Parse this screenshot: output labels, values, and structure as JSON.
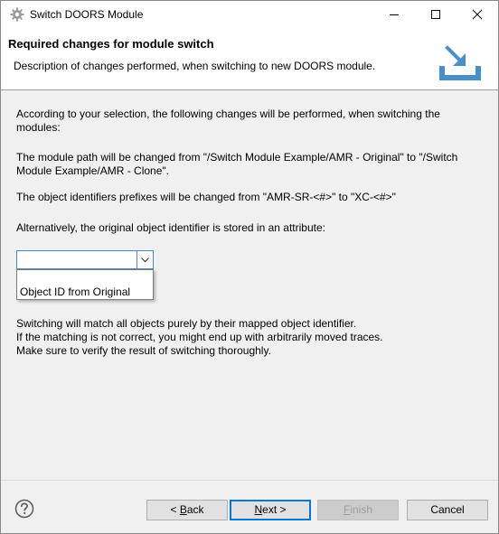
{
  "window": {
    "title": "Switch DOORS Module"
  },
  "banner": {
    "title": "Required changes for module switch",
    "description": "Description of changes performed, when switching to new DOORS module."
  },
  "content": {
    "intro_line1": "According to your selection, the following changes will be performed, when switching the",
    "intro_line2": "modules:",
    "path_line1": "The module path will be changed from \"/Switch Module Example/AMR - Original\" to \"/Switch",
    "path_line2": "Module Example/AMR - Clone\".",
    "prefix_line": "The object identifiers prefixes will be changed from \"AMR-SR-<#>\" to \"XC-<#>\"",
    "alt_line": "Alternatively, the original object identifier is stored in an attribute:",
    "attribute_combo": {
      "value": "",
      "options": [
        "",
        "Object ID from Original"
      ]
    },
    "warning_line1": "Switching will match all objects purely by their mapped object identifier.",
    "warning_line2": "If the matching is not correct, you might end up with arbitrarily moved traces.",
    "warning_line3": "Make sure to verify the result of switching thoroughly."
  },
  "buttons": {
    "back_prefix": "< ",
    "back_mnemonic": "B",
    "back_rest": "ack",
    "next_mnemonic": "N",
    "next_rest": "ext >",
    "finish_mnemonic": "F",
    "finish_rest": "inish",
    "cancel": "Cancel"
  },
  "icons": {
    "app": "gear-icon",
    "help": "help-icon",
    "banner": "import-tray-icon"
  },
  "colors": {
    "accent": "#0078d7",
    "combo_border": "#4a86c8",
    "banner_icon": "#4a8fc7"
  }
}
